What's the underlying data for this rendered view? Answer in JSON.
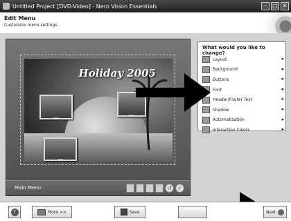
{
  "window": {
    "title": "Untitled Project [DVD-Video] - Nero Vision Essentials"
  },
  "header": {
    "title": "Edit Menu",
    "subtitle": "Customize menu settings."
  },
  "preview": {
    "menu_title": "Holiday 2005",
    "bottom_bar_label": "Main Menu"
  },
  "options_panel": {
    "title": "What would you like to change?",
    "items": [
      {
        "label": "Layout",
        "icon": "layout-icon"
      },
      {
        "label": "Background",
        "icon": "background-icon"
      },
      {
        "label": "Buttons",
        "icon": "buttons-icon"
      },
      {
        "label": "Font",
        "icon": "font-icon"
      },
      {
        "label": "Header/Footer Text",
        "icon": "header-footer-text-icon"
      },
      {
        "label": "Shadow",
        "icon": "shadow-icon"
      },
      {
        "label": "Automatization",
        "icon": "automatization-icon"
      },
      {
        "label": "Interaction Colors",
        "icon": "interaction-colors-icon"
      }
    ]
  },
  "footer": {
    "more_label": "More >>",
    "save_label": "Save",
    "next_label": "Next"
  }
}
